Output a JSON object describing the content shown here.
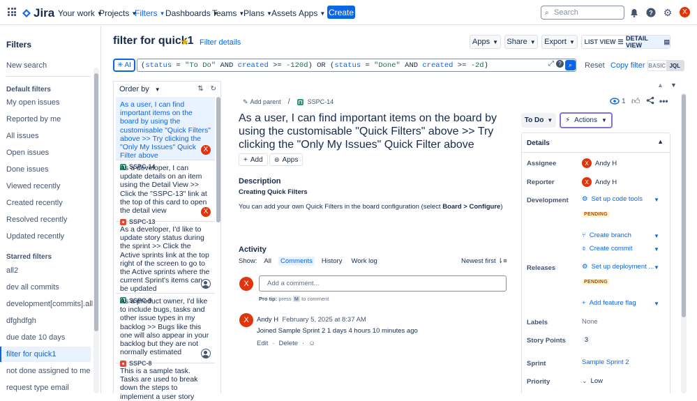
{
  "nav": {
    "product": "Jira",
    "menus": [
      "Your work",
      "Projects",
      "Filters",
      "Dashboards",
      "Teams",
      "Plans",
      "Assets",
      "Apps"
    ],
    "create": "Create",
    "search_placeholder": "Search",
    "avatar_initial": "X"
  },
  "sidebar": {
    "title": "Filters",
    "new_search": "New search",
    "default_heading": "Default filters",
    "default_items": [
      "My open issues",
      "Reported by me",
      "All issues",
      "Open issues",
      "Done issues",
      "Viewed recently",
      "Created recently",
      "Resolved recently",
      "Updated recently"
    ],
    "starred_heading": "Starred filters",
    "starred_items": [
      "all2",
      "dev all commits",
      "development[commits].all",
      "dfghdfgh",
      "due date 10 days",
      "filter for quick1",
      "not done assigned to me",
      "request type email"
    ]
  },
  "header": {
    "title": "filter for quick1",
    "filter_details": "Filter details",
    "apps": "Apps",
    "share": "Share",
    "export": "Export",
    "list_view": "LIST VIEW",
    "detail_view": "DETAIL VIEW"
  },
  "query": {
    "ai": "AI",
    "reset": "Reset",
    "copy_filter": "Copy filter",
    "basic": "BASIC",
    "jql": "JQL",
    "tokens": {
      "p1": "(",
      "k1": "status",
      "p2": " = ",
      "s1": "\"To Do\"",
      "p3": " AND ",
      "k2": "created",
      "p4": " >= ",
      "s2": "-120d",
      "p5": ") OR (",
      "k3": "status",
      "p6": " = ",
      "s3": "\"Done\"",
      "p7": " AND ",
      "k4": "created",
      "p8": " >= ",
      "s4": "-2d",
      "p9": ")"
    }
  },
  "list": {
    "order_by": "Order by",
    "cards": [
      {
        "text": "As a user, I can find important items on the board by using the customisable \"Quick Filters\" above >> Try clicking the \"Only My Issues\" Quick Filter above",
        "key": "SSPC-14",
        "type": "story",
        "avatar": "X"
      },
      {
        "text": "As a developer, I can update details on an item using the Detail View >> Click the \"SSPC-13\" link at the top of this card to open the detail view",
        "key": "SSPC-13",
        "type": "bug",
        "avatar": "X"
      },
      {
        "text": "As a developer, I'd like to update story status during the sprint >> Click the Active sprints link at the top right of the screen to go to the Active sprints where the current Sprint's items can be updated",
        "key": "SSPC-9",
        "type": "story",
        "avatar": ""
      },
      {
        "text": "As a product owner, I'd like to include bugs, tasks and other issue types in my backlog >> Bugs like this one will also appear in your backlog but they are not normally estimated",
        "key": "SSPC-8",
        "type": "bug",
        "avatar": ""
      },
      {
        "text": "This is a sample task. Tasks are used to break down the steps to implement a user story",
        "key": "",
        "type": "task",
        "avatar": ""
      }
    ]
  },
  "issue": {
    "add_parent": "Add parent",
    "key": "SSPC-14",
    "title": "As a user, I can find important items on the board by using the customisable \"Quick Filters\" above >> Try clicking the \"Only My Issues\" Quick Filter above",
    "add": "Add",
    "apps": "Apps",
    "description_heading": "Description",
    "description_sub": "Creating Quick Filters",
    "description_text_a": "You can add your own Quick Filters in the board configuration (select ",
    "description_text_b": "Board > Configure",
    "description_text_c": ")",
    "watchers": "1",
    "status": "To Do",
    "actions": "Actions"
  },
  "activity": {
    "heading": "Activity",
    "show": "Show:",
    "tabs": [
      "All",
      "Comments",
      "History",
      "Work log"
    ],
    "sort": "Newest first",
    "comment_placeholder": "Add a comment...",
    "protip_a": "Pro tip:",
    "protip_b": "press",
    "protip_key": "M",
    "protip_c": "to comment",
    "entry_author": "Andy H",
    "entry_date": "February 5, 2025 at 8:37 AM",
    "entry_text": "Joined Sample Sprint 2 1 days 4 hours 10 minutes ago",
    "edit": "Edit",
    "delete": "Delete",
    "avatar_initial": "X"
  },
  "details": {
    "heading": "Details",
    "assignee_label": "Assignee",
    "assignee": "Andy H",
    "reporter_label": "Reporter",
    "reporter": "Andy H",
    "development_label": "Development",
    "setup_code": "Set up code tools",
    "pending": "PENDING",
    "create_branch": "Create branch",
    "create_commit": "Create commit",
    "releases_label": "Releases",
    "setup_deploy": "Set up deployment ...",
    "add_flag": "Add feature flag",
    "labels_label": "Labels",
    "labels": "None",
    "story_points_label": "Story Points",
    "story_points": "3",
    "sprint_label": "Sprint",
    "sprint": "Sample Sprint 2",
    "priority_label": "Priority",
    "priority": "Low"
  },
  "colors": {
    "accent": "#0c66e4",
    "avatar": "#de350b",
    "story": "#22a06b",
    "bug": "#e34935",
    "actions_border": "#8270db"
  }
}
